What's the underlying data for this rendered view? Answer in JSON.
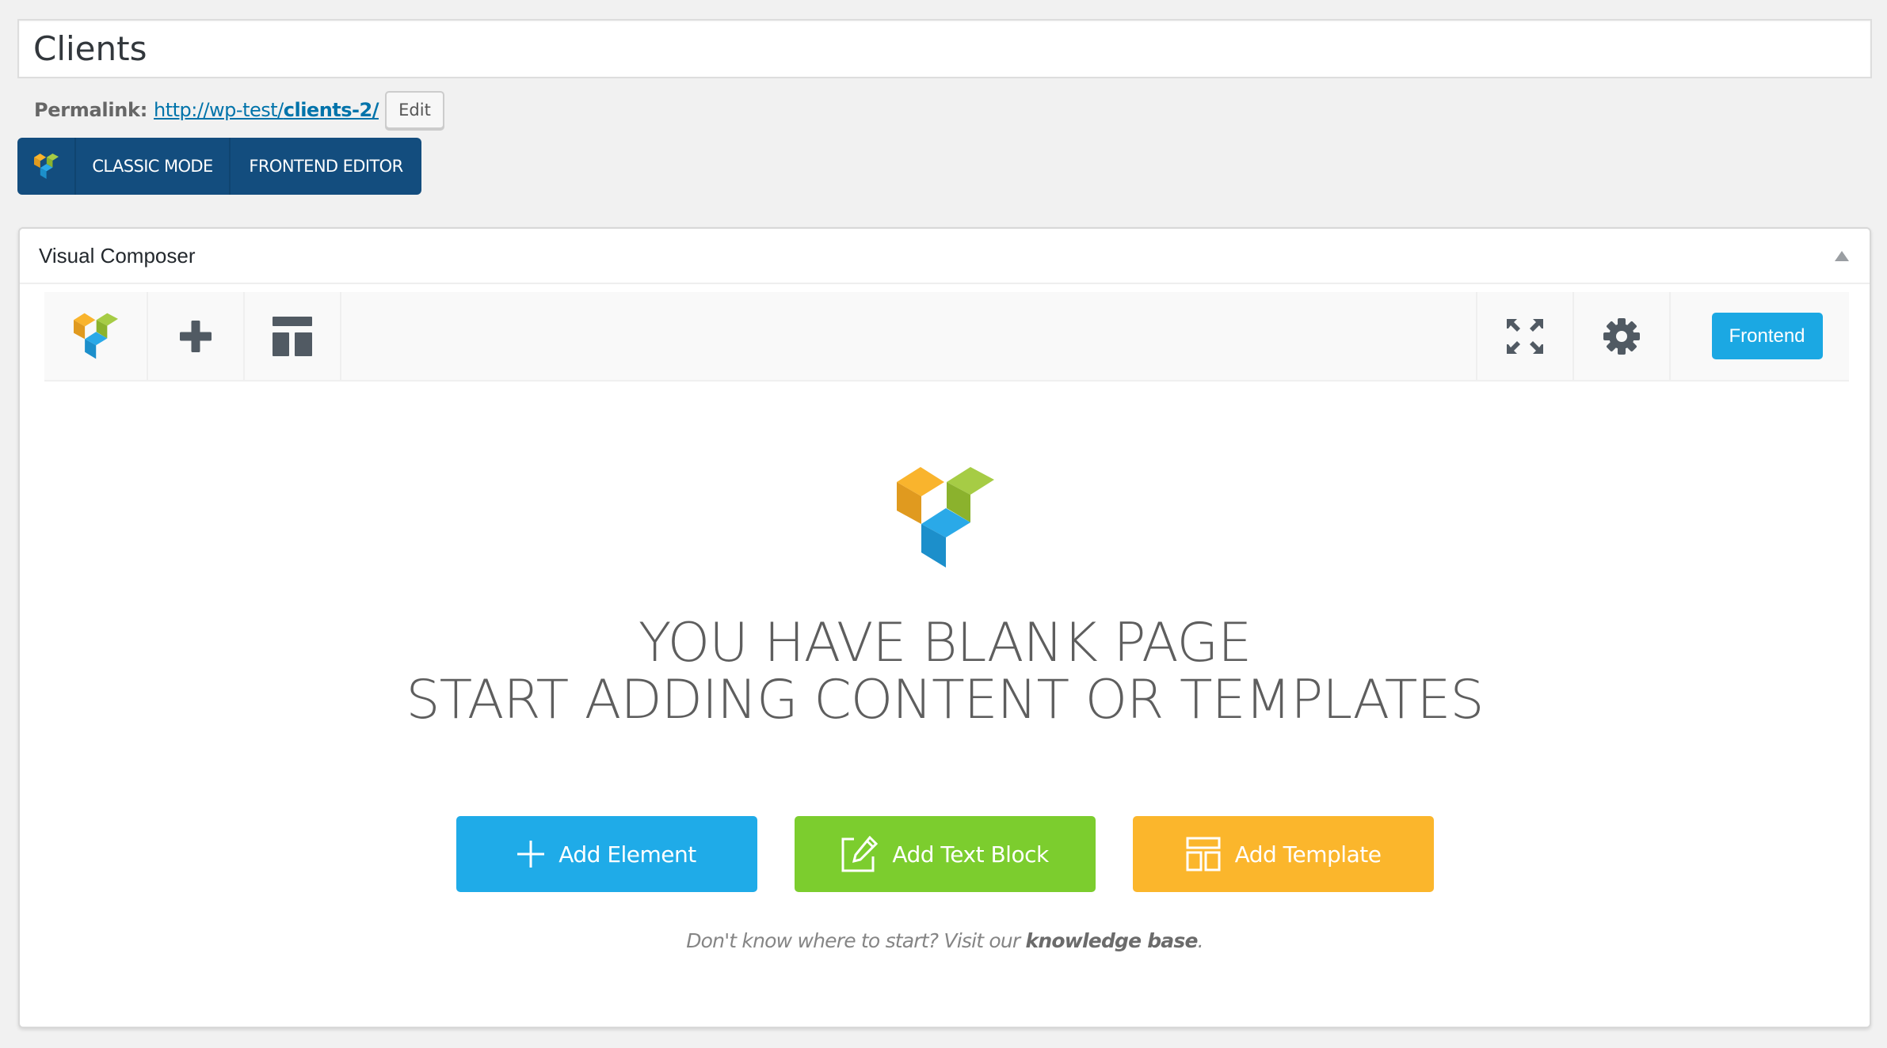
{
  "post": {
    "title_value": "Clients",
    "permalink_label": "Permalink:",
    "permalink_base": "http://wp-test/",
    "permalink_slug": "clients-2/",
    "edit_label": "Edit"
  },
  "mode_bar": {
    "logo_icon": "visual-composer-logo",
    "classic_label": "CLASSIC MODE",
    "frontend_label": "FRONTEND EDITOR"
  },
  "panel": {
    "title": "Visual Composer",
    "collapse_icon": "triangle-up",
    "toolbar": {
      "left_icons": [
        "visual-composer-logo",
        "plus-icon",
        "template-layout-icon"
      ],
      "right_icons": [
        "fullscreen-expand-icon",
        "gear-icon"
      ],
      "frontend_label": "Frontend"
    },
    "empty_state": {
      "line1": "YOU HAVE BLANK PAGE",
      "line2": "START ADDING CONTENT OR TEMPLATES",
      "buttons": [
        {
          "label": "Add Element",
          "icon": "plus-icon",
          "color": "#1fabe8"
        },
        {
          "label": "Add Text Block",
          "icon": "edit-document-icon",
          "color": "#7ccd2e"
        },
        {
          "label": "Add Template",
          "icon": "template-layout-icon",
          "color": "#fbb62c"
        }
      ],
      "help_prefix": "Don't know where to start? Visit our ",
      "help_link": "knowledge base",
      "help_suffix": "."
    }
  },
  "colors": {
    "mode_bar_bg": "#134d7e",
    "frontend_button": "#1ba8e3",
    "icon_gray": "#515a63",
    "logo_orange": "#f6a623",
    "logo_green": "#a3c93a",
    "logo_blue": "#23a6e6"
  }
}
